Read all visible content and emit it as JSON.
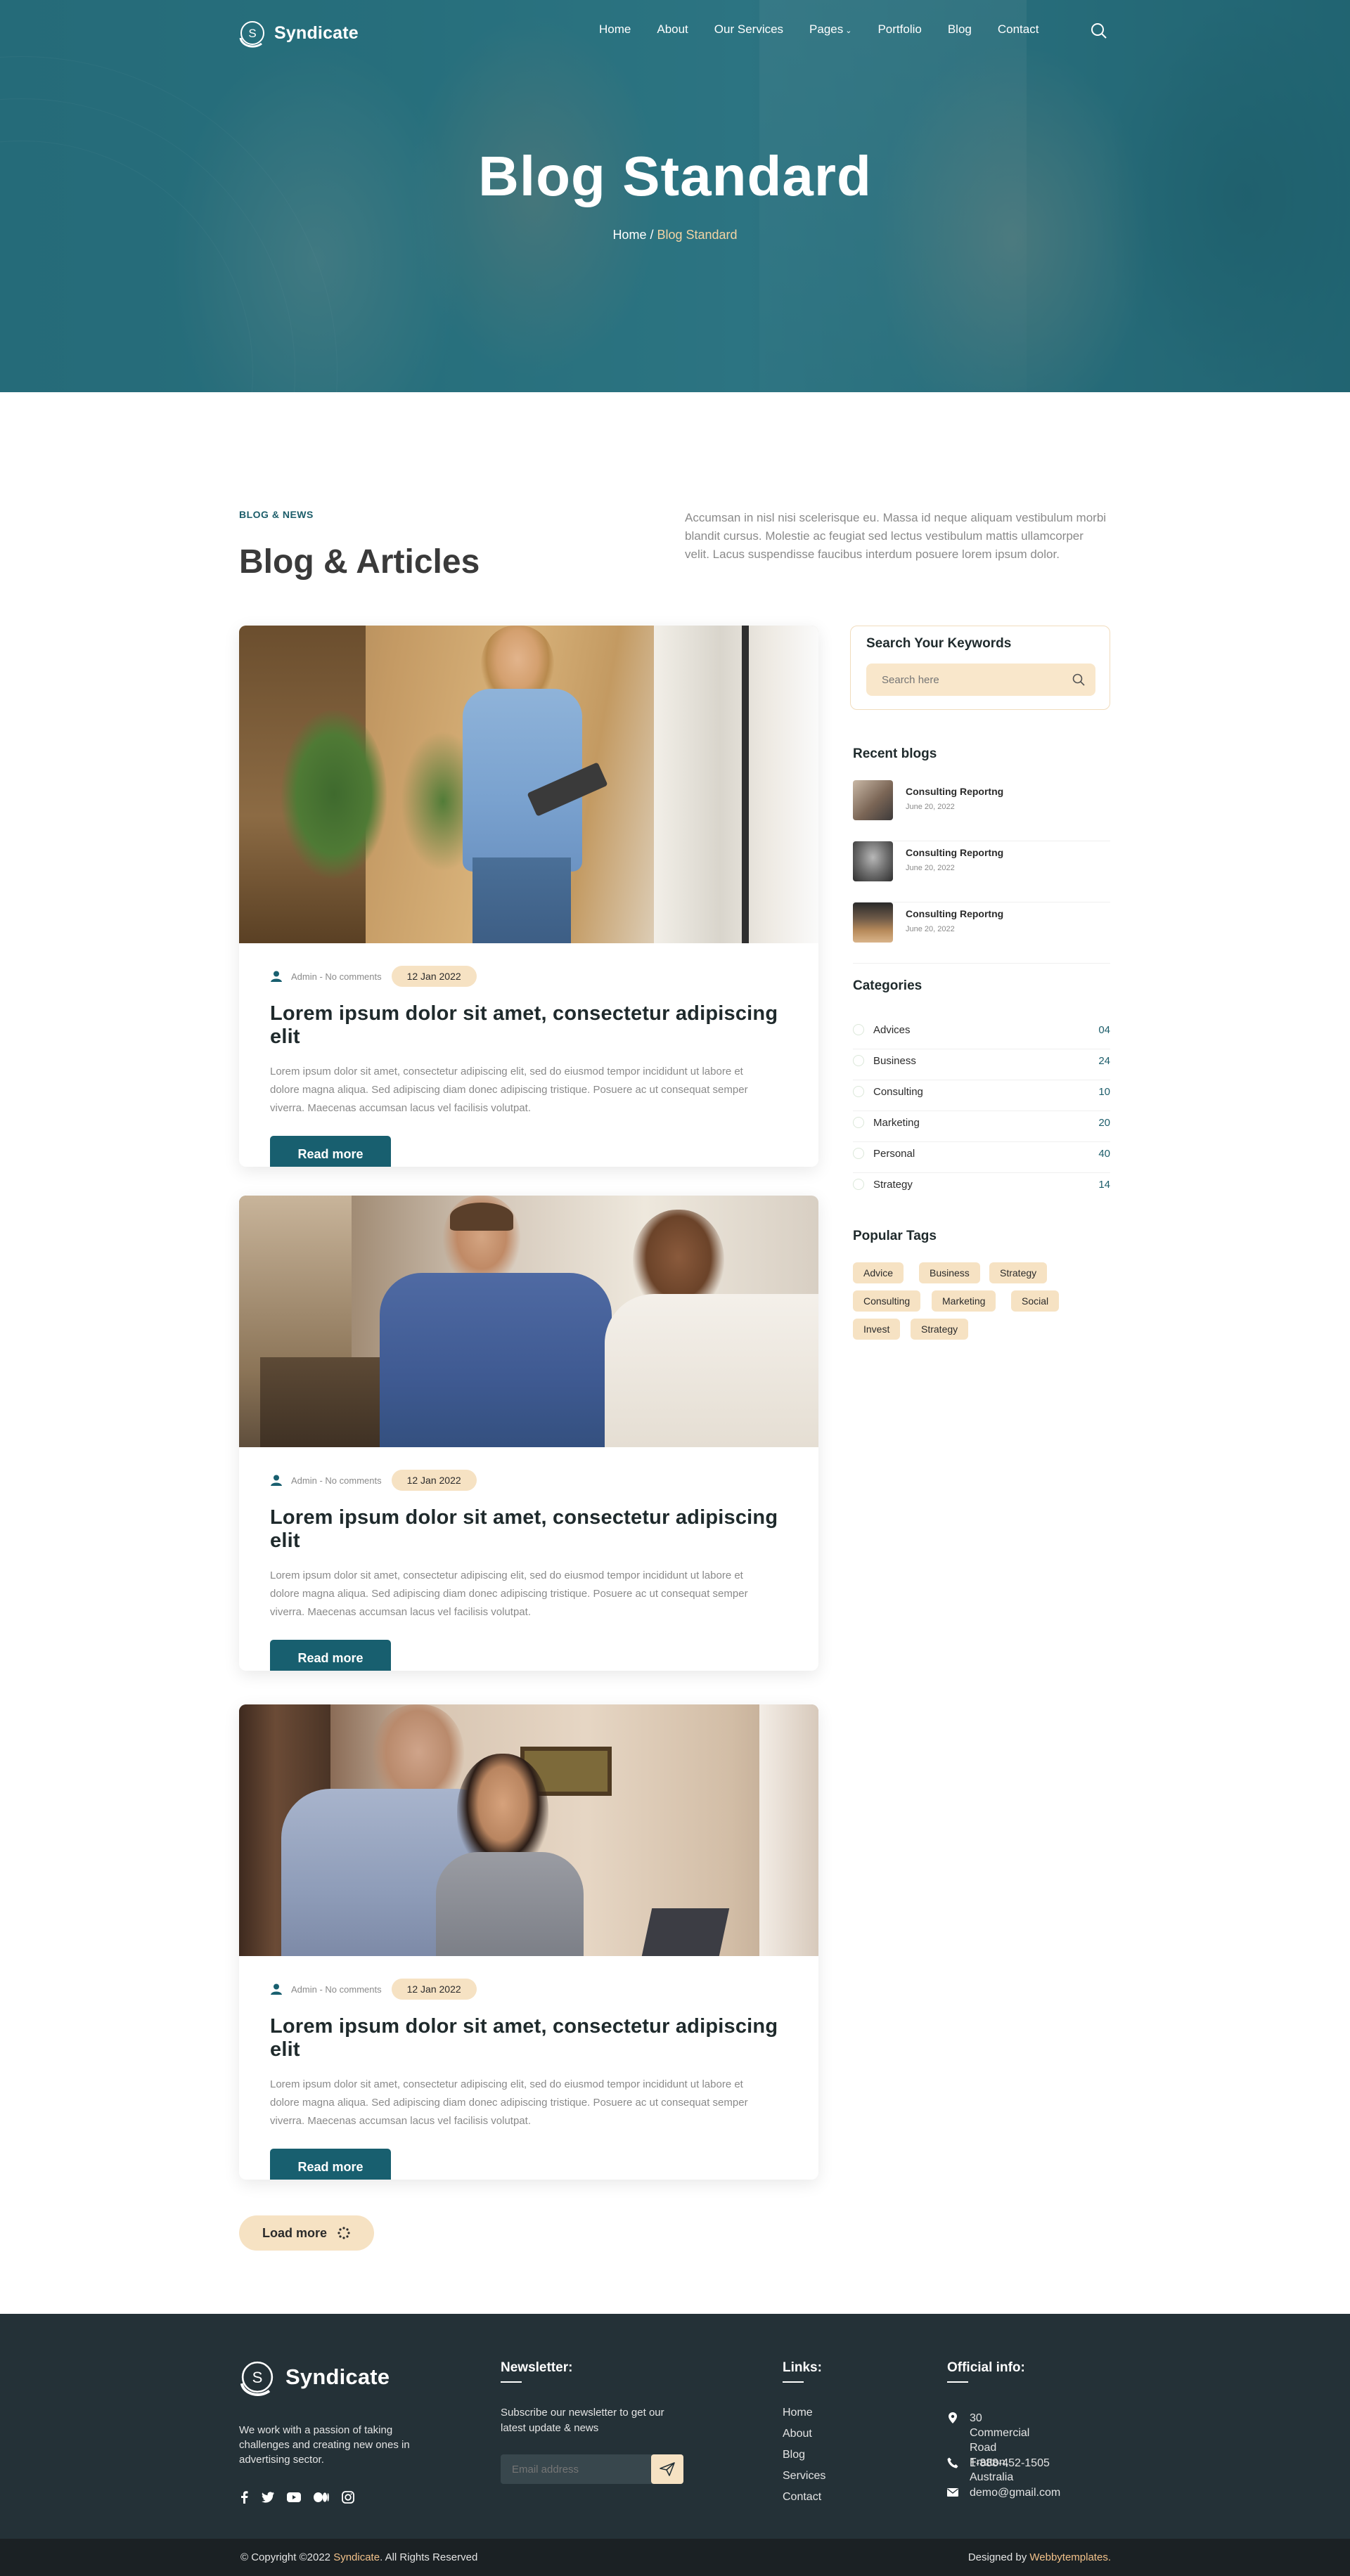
{
  "brand": {
    "name": "Syndicate"
  },
  "nav": {
    "items": [
      "Home",
      "About",
      "Our Services",
      "Pages",
      "Portfolio",
      "Blog",
      "Contact"
    ],
    "dropdown_marker": "⌄"
  },
  "hero": {
    "title": "Blog  Standard",
    "breadcrumb_home": "Home",
    "breadcrumb_sep": " / ",
    "breadcrumb_current": "Blog Standard"
  },
  "intro": {
    "kicker": "BLOG & NEWS",
    "title": "Blog & Articles",
    "text": "Accumsan in nisl nisi scelerisque eu. Massa id neque aliquam vestibulum morbi blandit cursus. Molestie ac feugiat sed lectus vestibulum mattis ullamcorper velit. Lacus suspendisse faucibus interdum posuere lorem ipsum dolor."
  },
  "posts": [
    {
      "meta": "Admin - No comments",
      "date": "12 Jan 2022",
      "title": "Lorem ipsum dolor sit amet, consectetur adipiscing elit",
      "excerpt": "Lorem ipsum dolor sit amet, consectetur adipiscing elit, sed do eiusmod tempor incididunt ut labore et dolore magna aliqua. Sed adipiscing diam donec adipiscing tristique. Posuere ac ut consequat semper viverra. Maecenas accumsan lacus vel facilisis volutpat.",
      "button": "Read more"
    },
    {
      "meta": "Admin - No comments",
      "date": "12 Jan 2022",
      "title": "Lorem ipsum dolor sit amet, consectetur adipiscing elit",
      "excerpt": "Lorem ipsum dolor sit amet, consectetur adipiscing elit, sed do eiusmod tempor incididunt ut labore et dolore magna aliqua. Sed adipiscing diam donec adipiscing tristique. Posuere ac ut consequat semper viverra. Maecenas accumsan lacus vel facilisis volutpat.",
      "button": "Read more"
    },
    {
      "meta": "Admin - No comments",
      "date": "12 Jan 2022",
      "title": "Lorem ipsum dolor sit amet, consectetur adipiscing elit",
      "excerpt": "Lorem ipsum dolor sit amet, consectetur adipiscing elit, sed do eiusmod tempor incididunt ut labore et dolore magna aliqua. Sed adipiscing diam donec adipiscing tristique. Posuere ac ut consequat semper viverra. Maecenas accumsan lacus vel facilisis volutpat.",
      "button": "Read more"
    }
  ],
  "load_more": "Load more",
  "sidebar": {
    "search_title": "Search Your Keywords",
    "search_placeholder": "Search here",
    "recent_title": "Recent blogs",
    "recent": [
      {
        "title": "Consulting Reportng",
        "date": "June 20, 2022"
      },
      {
        "title": "Consulting Reportng",
        "date": "June 20, 2022"
      },
      {
        "title": "Consulting Reportng",
        "date": "June 20, 2022"
      }
    ],
    "categories_title": "Categories",
    "categories": [
      {
        "name": "Advices",
        "count": "04"
      },
      {
        "name": "Business",
        "count": "24"
      },
      {
        "name": "Consulting",
        "count": "10"
      },
      {
        "name": "Marketing",
        "count": "20"
      },
      {
        "name": "Personal",
        "count": "40"
      },
      {
        "name": "Strategy",
        "count": "14"
      }
    ],
    "tags_title": "Popular Tags",
    "tags": [
      "Advice",
      "Business",
      "Strategy",
      "Consulting",
      "Marketing",
      "Social",
      "Invest",
      "Strategy"
    ]
  },
  "footer": {
    "about": "We work with a passion of taking challenges and creating new ones in advertising sector.",
    "newsletter_title": "Newsletter:",
    "newsletter_text": "Subscribe our newsletter to get our latest update & news",
    "email_placeholder": "Email address",
    "links_title": "Links:",
    "links": [
      "Home",
      "About",
      "Blog",
      "Services",
      "Contact"
    ],
    "info_title": "Official info:",
    "address": "30 Commercial Road\nFratton, Australia",
    "phone": "1-888-452-1505",
    "email": "demo@gmail.com",
    "copyright_pre": "© Copyright ©2022 ",
    "copyright_brand": "Syndicate",
    "copyright_post": ". All Rights Reserved",
    "designed_pre": "Designed by ",
    "designed_brand": "Webbytemplates."
  },
  "colors": {
    "teal": "#185f6f",
    "cream": "#f6e2c3",
    "dark": "#243137",
    "accent": "#f3c28a"
  }
}
